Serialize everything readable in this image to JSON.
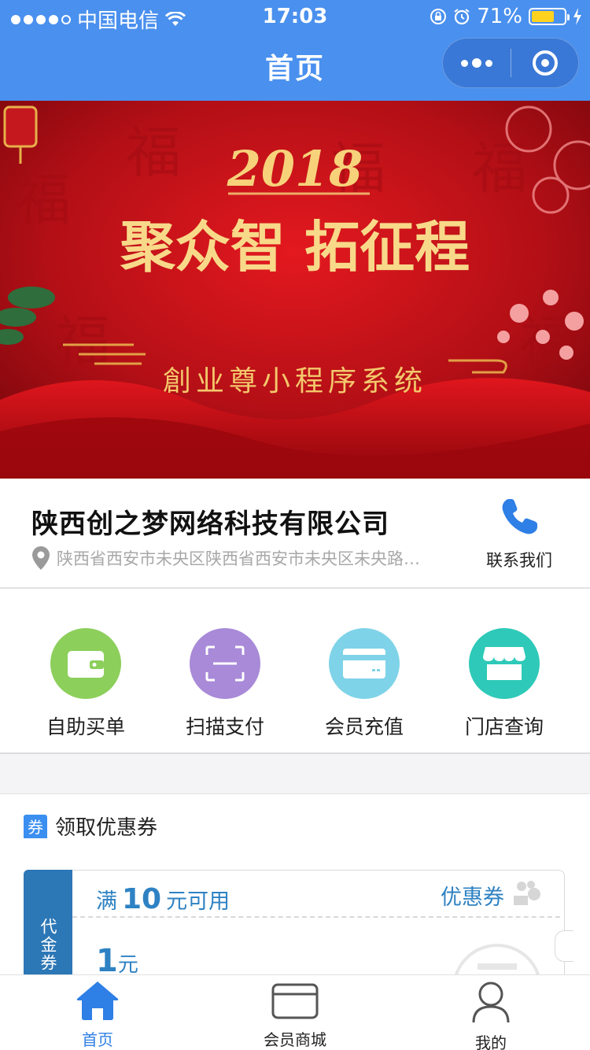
{
  "status_bar": {
    "carrier": "中国电信",
    "time": "17:03",
    "battery": "71%",
    "battery_level": 0.71
  },
  "nav": {
    "title": "首页"
  },
  "banner": {
    "year": "2018",
    "slogan": "聚众智 拓征程",
    "subtitle": "創业尊小程序系统",
    "colors": {
      "primary": "#c8141a",
      "gold": "#f5c65a"
    }
  },
  "company": {
    "name": "陕西创之梦网络科技有限公司",
    "address": "陕西省西安市未央区陕西省西安市未央区未央路…",
    "contact_label": "联系我们"
  },
  "quick_actions": [
    {
      "label": "自助买单",
      "icon": "wallet-icon",
      "color": "#8ccf5b"
    },
    {
      "label": "扫描支付",
      "icon": "scan-icon",
      "color": "#a88ad8"
    },
    {
      "label": "会员充值",
      "icon": "card-icon",
      "color": "#7fd3e8"
    },
    {
      "label": "门店查询",
      "icon": "store-icon",
      "color": "#2ec9b8"
    }
  ],
  "coupon_section": {
    "tag": "券",
    "title": "领取优惠券",
    "coupon": {
      "side_label": "代金券",
      "condition_prefix": "满",
      "condition_amount": "10",
      "condition_suffix": "元可用",
      "kind": "优惠券",
      "value": "1",
      "unit": "元"
    }
  },
  "tabbar": {
    "items": [
      {
        "label": "首页",
        "icon": "home-icon",
        "active": true
      },
      {
        "label": "会员商城",
        "icon": "card-outline-icon",
        "active": false
      },
      {
        "label": "我的",
        "icon": "user-icon",
        "active": false
      }
    ],
    "active_color": "#2e7fe6"
  }
}
